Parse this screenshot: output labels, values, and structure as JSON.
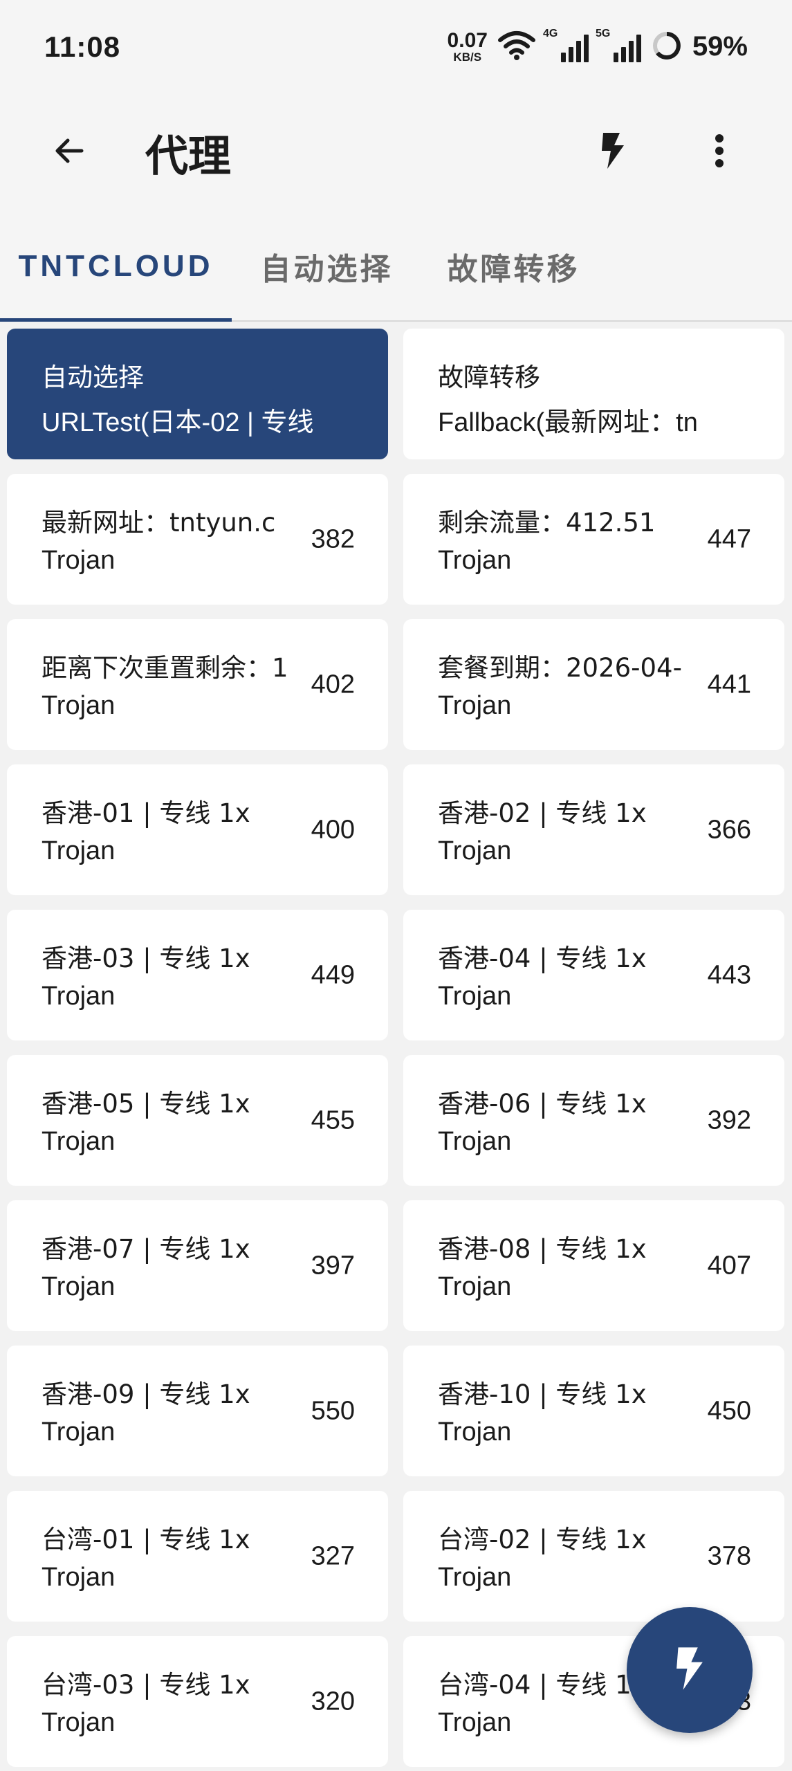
{
  "status_bar": {
    "time": "11:08",
    "net_speed_value": "0.07",
    "net_speed_unit": "KB/S",
    "sig1_tag": "4G",
    "sig2_tag": "5G",
    "battery": "59%"
  },
  "app_bar": {
    "title": "代理"
  },
  "tabs": [
    {
      "label": "TNTCLOUD",
      "active": true
    },
    {
      "label": "自动选择",
      "active": false
    },
    {
      "label": "故障转移",
      "active": false
    }
  ],
  "proxies": [
    {
      "name": "自动选择",
      "type": "URLTest(日本-02 | 专线",
      "delay": "",
      "selected": true
    },
    {
      "name": "故障转移",
      "type": "Fallback(最新网址：tn",
      "delay": "",
      "selected": false
    },
    {
      "name": "最新网址：tntyun.c",
      "type": "Trojan",
      "delay": "382"
    },
    {
      "name": "剩余流量：412.51",
      "type": "Trojan",
      "delay": "447"
    },
    {
      "name": "距离下次重置剩余：1",
      "type": "Trojan",
      "delay": "402"
    },
    {
      "name": "套餐到期：2026-04-",
      "type": "Trojan",
      "delay": "441"
    },
    {
      "name": "香港-01 | 专线 1x",
      "type": "Trojan",
      "delay": "400"
    },
    {
      "name": "香港-02 | 专线 1x",
      "type": "Trojan",
      "delay": "366"
    },
    {
      "name": "香港-03 | 专线 1x",
      "type": "Trojan",
      "delay": "449"
    },
    {
      "name": "香港-04 | 专线 1x",
      "type": "Trojan",
      "delay": "443"
    },
    {
      "name": "香港-05 | 专线 1x",
      "type": "Trojan",
      "delay": "455"
    },
    {
      "name": "香港-06 | 专线 1x",
      "type": "Trojan",
      "delay": "392"
    },
    {
      "name": "香港-07 | 专线 1x",
      "type": "Trojan",
      "delay": "397"
    },
    {
      "name": "香港-08 | 专线 1x",
      "type": "Trojan",
      "delay": "407"
    },
    {
      "name": "香港-09 | 专线 1x",
      "type": "Trojan",
      "delay": "550"
    },
    {
      "name": "香港-10 | 专线 1x",
      "type": "Trojan",
      "delay": "450"
    },
    {
      "name": "台湾-01 | 专线 1x",
      "type": "Trojan",
      "delay": "327"
    },
    {
      "name": "台湾-02 | 专线 1x",
      "type": "Trojan",
      "delay": "378"
    },
    {
      "name": "台湾-03 | 专线 1x",
      "type": "Trojan",
      "delay": "320"
    },
    {
      "name": "台湾-04 | 专线 1x",
      "type": "Trojan",
      "delay": "3"
    }
  ],
  "icons": {
    "back": "arrow-left-icon",
    "test": "bolt-icon",
    "more": "more-vert-icon",
    "fab": "bolt-icon"
  },
  "colors": {
    "accent": "#27467a",
    "background": "#f2f2f2",
    "card": "#ffffff"
  }
}
